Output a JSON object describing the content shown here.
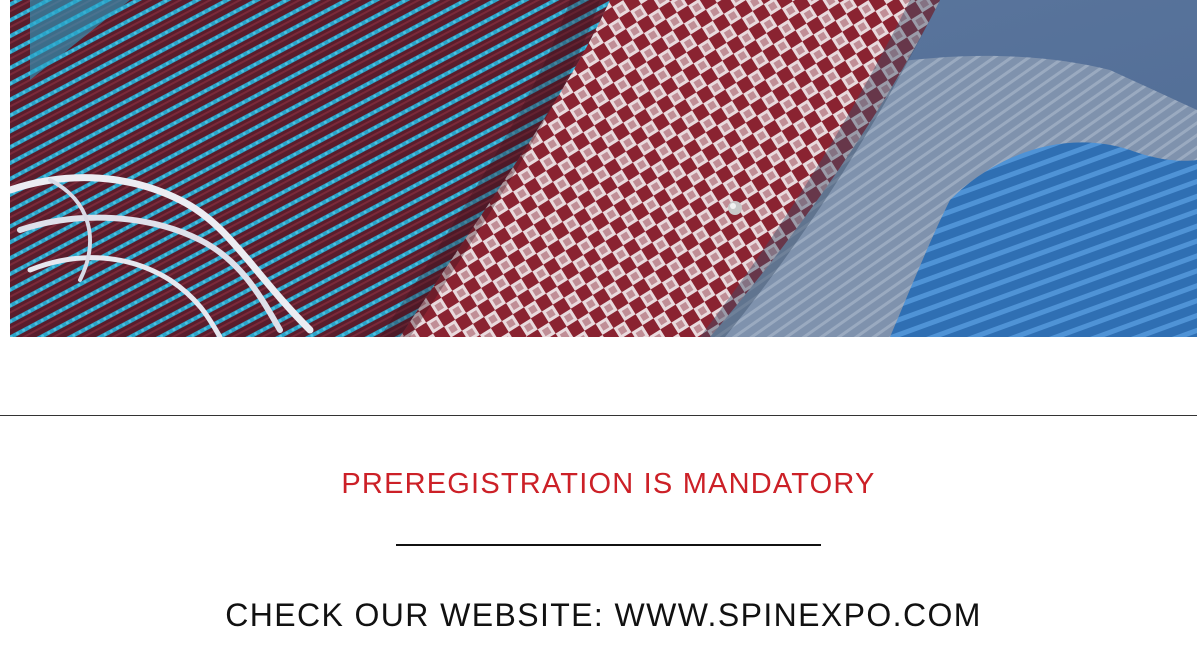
{
  "hero": {
    "image_name": "knitted-fabric-swatches"
  },
  "notice": {
    "headline": "PREREGISTRATION IS MANDATORY",
    "headline_color": "#cc2027",
    "cta": "CHECK OUR WEBSITE: WWW.SPINEXPO.COM"
  }
}
